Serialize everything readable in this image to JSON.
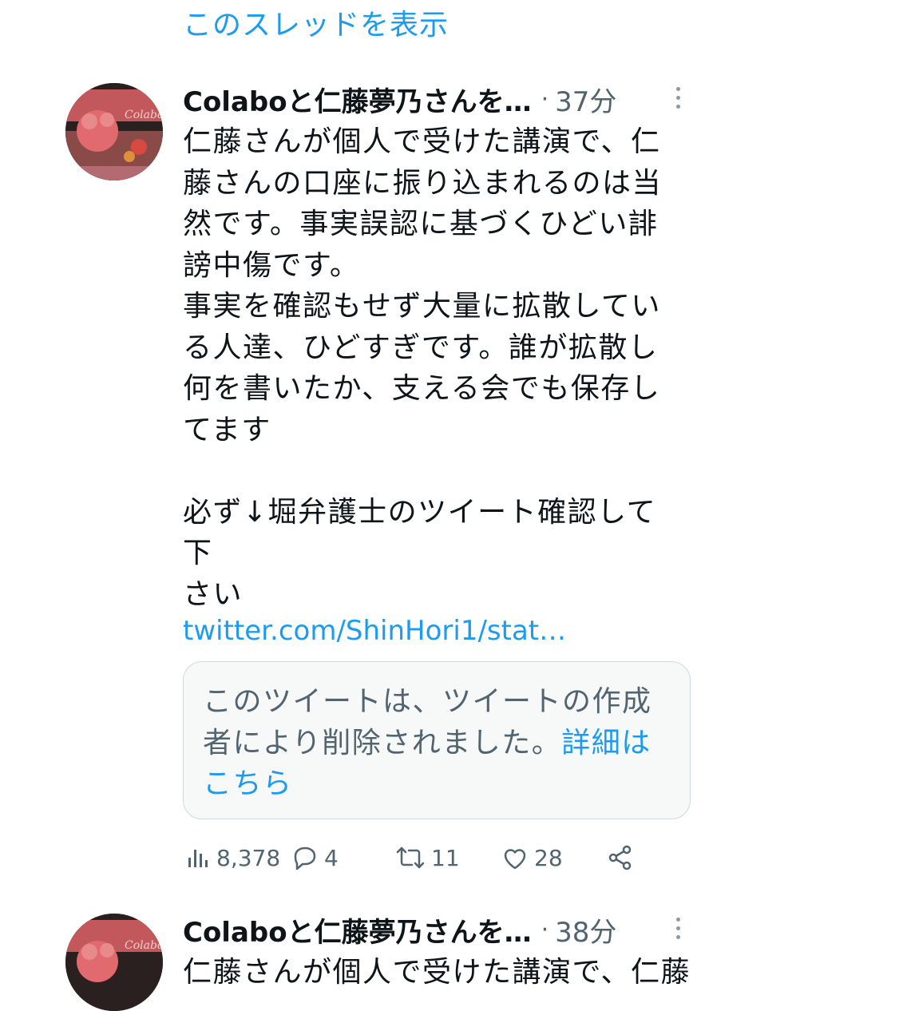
{
  "thread_link": "このスレッドを表示",
  "tweets": [
    {
      "name": "Colaboと仁藤夢乃さんを…",
      "separator": "·",
      "time": "37分",
      "body_lines": [
        "仁藤さんが個人で受けた講演で、仁",
        "藤さんの口座に振り込まれるのは当",
        "然です。事実誤認に基づくひどい誹",
        "謗中傷です。",
        "事実を確認もせず大量に拡散してい",
        "る人達、ひどすぎです。誰が拡散し",
        "何を書いたか、支える会でも保存し",
        "てます",
        "",
        "必ず↓堀弁護士のツイート確認して下",
        "さい"
      ],
      "link": "twitter.com/ShinHori1/stat…",
      "quote": {
        "text": "このツイートは、ツイートの作成者により削除されました。",
        "more_link": "詳細はこちら"
      },
      "actions": {
        "views": "8,378",
        "replies": "4",
        "retweets": "11",
        "likes": "28"
      },
      "avatar_logo": "Colabo"
    },
    {
      "name": "Colaboと仁藤夢乃さんを…",
      "separator": "·",
      "time": "38分",
      "partial_text": "仁藤さんが個人で受けた講演で、仁藤",
      "avatar_logo": "Colabo"
    }
  ],
  "colors": {
    "accent": "#1d9bf0",
    "secondary_text": "#536471",
    "primary_text": "#0f1419"
  }
}
